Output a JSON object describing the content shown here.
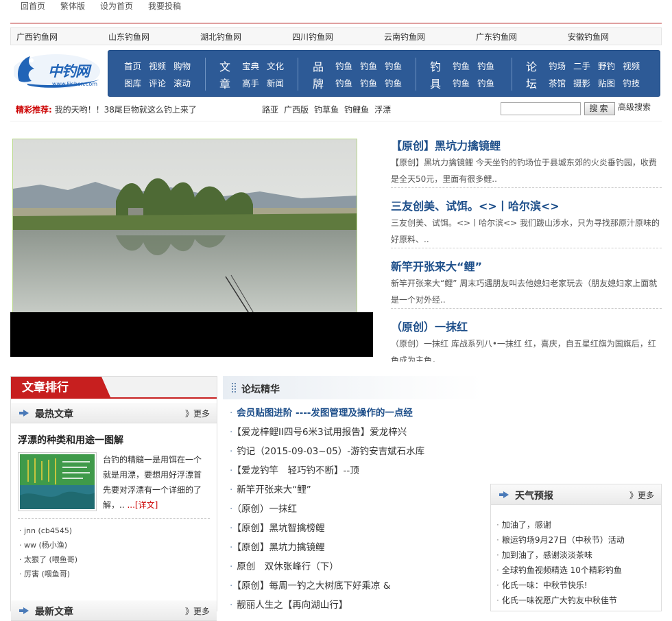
{
  "topbar": [
    "回首页",
    "繁体版",
    "设为首页",
    "我要投稿"
  ],
  "regions": [
    "广西钓鱼网",
    "山东钓鱼网",
    "湖北钓鱼网",
    "四川钓鱼网",
    "云南钓鱼网",
    "广东钓鱼网",
    "安徽钓鱼网"
  ],
  "logo": {
    "text": "中钓网",
    "url": "www.Fishcn.com"
  },
  "nav": {
    "g1": {
      "r1": [
        "首页",
        "视频",
        "购物"
      ],
      "r2": [
        "图库",
        "评论",
        "滚动"
      ]
    },
    "g2": {
      "big1": "文",
      "big2": "章",
      "r1": [
        "宝典",
        "文化"
      ],
      "r2": [
        "高手",
        "新闻"
      ]
    },
    "g3": {
      "big1": "品",
      "big2": "牌",
      "r1": [
        "钓鱼",
        "钓鱼",
        "钓鱼"
      ],
      "r2": [
        "钓鱼",
        "钓鱼",
        "钓鱼"
      ]
    },
    "g4": {
      "big1": "钓",
      "big2": "具",
      "r1": [
        "钓鱼",
        "钓鱼"
      ],
      "r2": [
        "钓鱼",
        "钓鱼"
      ]
    },
    "g5": {
      "big1": "论",
      "big2": "坛",
      "r1": [
        "钓场",
        "二手",
        "野钓",
        "视频"
      ],
      "r2": [
        "茶馆",
        "摄影",
        "贴图",
        "钓技"
      ]
    }
  },
  "recommend": {
    "label": "精彩推荐:",
    "text": "我的天哟！！38尾巨物就这么钓上来了"
  },
  "tags": [
    "路亚",
    "广西版",
    "钓草鱼",
    "钓鲤鱼",
    "浮漂"
  ],
  "search": {
    "button": "搜索",
    "advanced": "高级搜索",
    "value": ""
  },
  "news": [
    {
      "title": "【原创】黑坑力擒镜鲤",
      "desc": "【原创】黑坑力擒镜鲤 今天坐钓的钓场位于县城东郊的火炎垂钓园，收费是全天50元，里面有很多鲤.."
    },
    {
      "title": "三友创美、试饵。<>丨哈尔滨<>",
      "desc": "三友创美、试饵。<>丨哈尔滨<> 我们跋山涉水，只为寻找那原汁原味的好原料、.."
    },
    {
      "title": "新竿开张来大“鲤”",
      "desc": "新竿开张来大“鲤” 周末巧遇朋友叫去他媳妇老家玩去（朋友媳妇家上面就是一个对外经.."
    },
    {
      "title": "（原创）一抹红",
      "desc": "（原创）一抹红 库战系列八•一抹红 红，喜庆，自五星红旗为国旗后，红色成为主色，"
    }
  ],
  "rank": {
    "tab": "文章排行",
    "hot_title": "最热文章",
    "more": "》更多",
    "featured": {
      "title": "浮漂的种类和用途一图解",
      "text": "台钓的精髓一是用饵在一个就是用漂，要想用好浮漂首先要对浮漂有一个详细的了解，..",
      "more": "...[详文]"
    },
    "hot_list": [
      "jnn (cb4545)",
      "ww (杨小渔)",
      "太狠了 (喂鱼哥)",
      "厉害 (喂鱼哥)"
    ],
    "new_title": "最新文章"
  },
  "forum": {
    "title": "论坛精华",
    "items": [
      "会员贴图进阶 ----发图管理及操作的一点经",
      "【爱龙梓鲤II四号6米3试用报告】爱龙梓兴",
      "钓记（2015-09-03~05）-游钓安吉斌石水库",
      "【爱龙钓竿　轻巧钓不断】--顶",
      "新竿开张来大“鲤”",
      "（原创）一抹红",
      "【原创】黑坑智擒榜鲤",
      "【原创】黑坑力擒镜鲤",
      "原创　双休张峰行（下）",
      "【原创】每周一钓之大树底下好乘凉 &",
      "靓丽人生之【再向湖山行】"
    ]
  },
  "weather": {
    "title": "天气预报",
    "more": "》更多",
    "items": [
      "加油了，感谢",
      "粮运钓场9月27日（中秋节）活动",
      "加到油了，感谢淡淡茶味",
      "全球钓鱼视频精选 10个精彩钓鱼",
      "化氏一味：中秋节快乐!",
      "化氏一味祝愿广大钓友中秋佳节"
    ]
  },
  "colors": {
    "nav_bg": "#2d5a96",
    "accent_red": "#c71f1f",
    "link_blue": "#1e4f8a"
  }
}
